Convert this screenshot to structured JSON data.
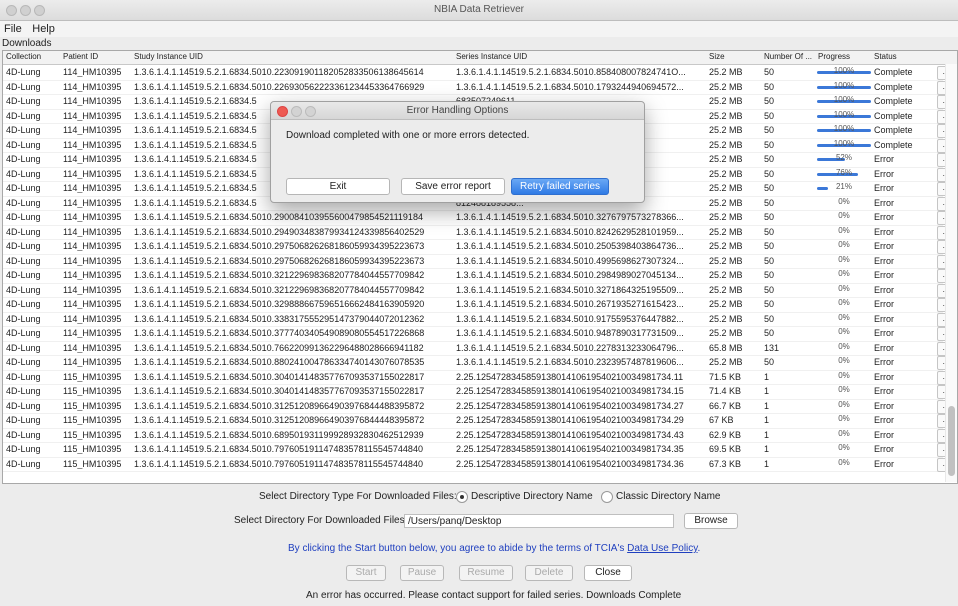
{
  "window": {
    "title": "NBIA Data Retriever"
  },
  "menu": [
    "File",
    "Help"
  ],
  "section_label": "Downloads",
  "columns": [
    "Collection",
    "Patient ID",
    "Study Instance UID",
    "Series Instance UID",
    "Size",
    "Number Of ...",
    "Progress",
    "Status"
  ],
  "rows": [
    {
      "collection": "4D-Lung",
      "patient": "114_HM10395",
      "study": "1.3.6.1.4.1.14519.5.2.1.6834.5010.223091901182052833506138645614",
      "series": "1.3.6.1.4.1.14519.5.2.1.6834.5010.858408007824741O...",
      "size": "25.2 MB",
      "number": "50",
      "progress": 100,
      "pct": "100%",
      "status": "Complete"
    },
    {
      "collection": "4D-Lung",
      "patient": "114_HM10395",
      "study": "1.3.6.1.4.1.14519.5.2.1.6834.5010.226930562223361234453364766929",
      "series": "1.3.6.1.4.1.14519.5.2.1.6834.5010.17932449406945­72...",
      "size": "25.2 MB",
      "number": "50",
      "progress": 100,
      "pct": "100%",
      "status": "Complete"
    },
    {
      "collection": "4D-Lung",
      "patient": "114_HM10395",
      "study": "1.3.6.1.4.1.14519.5.2.1.6834.5",
      "series": "683507249611...",
      "size": "25.2 MB",
      "number": "50",
      "progress": 100,
      "pct": "100%",
      "status": "Complete"
    },
    {
      "collection": "4D-Lung",
      "patient": "114_HM10395",
      "study": "1.3.6.1.4.1.14519.5.2.1.6834.5",
      "series": "489989233820...",
      "size": "25.2 MB",
      "number": "50",
      "progress": 100,
      "pct": "100%",
      "status": "Complete"
    },
    {
      "collection": "4D-Lung",
      "patient": "114_HM10395",
      "study": "1.3.6.1.4.1.14519.5.2.1.6834.5",
      "series": "155783428324...",
      "size": "25.2 MB",
      "number": "50",
      "progress": 100,
      "pct": "100%",
      "status": "Complete"
    },
    {
      "collection": "4D-Lung",
      "patient": "114_HM10395",
      "study": "1.3.6.1.4.1.14519.5.2.1.6834.5",
      "series": "511404411627...",
      "size": "25.2 MB",
      "number": "50",
      "progress": 100,
      "pct": "100%",
      "status": "Complete"
    },
    {
      "collection": "4D-Lung",
      "patient": "114_HM10395",
      "study": "1.3.6.1.4.1.14519.5.2.1.6834.5",
      "series": "794725798723...",
      "size": "25.2 MB",
      "number": "50",
      "progress": 52,
      "pct": "52%",
      "status": "Error"
    },
    {
      "collection": "4D-Lung",
      "patient": "114_HM10395",
      "study": "1.3.6.1.4.1.14519.5.2.1.6834.5",
      "series": "663802629487...",
      "size": "25.2 MB",
      "number": "50",
      "progress": 76,
      "pct": "76%",
      "status": "Error"
    },
    {
      "collection": "4D-Lung",
      "patient": "114_HM10395",
      "study": "1.3.6.1.4.1.14519.5.2.1.6834.5",
      "series": "465140066424...",
      "size": "25.2 MB",
      "number": "50",
      "progress": 21,
      "pct": "21%",
      "status": "Error"
    },
    {
      "collection": "4D-Lung",
      "patient": "114_HM10395",
      "study": "1.3.6.1.4.1.14519.5.2.1.6834.5",
      "series": "812488189558...",
      "size": "25.2 MB",
      "number": "50",
      "progress": 0,
      "pct": "0%",
      "status": "Error"
    },
    {
      "collection": "4D-Lung",
      "patient": "114_HM10395",
      "study": "1.3.6.1.4.1.14519.5.2.1.6834.5010.290084103955600479854521119184",
      "series": "1.3.6.1.4.1.14519.5.2.1.6834.5010.3276797573278366...",
      "size": "25.2 MB",
      "number": "50",
      "progress": 0,
      "pct": "0%",
      "status": "Error"
    },
    {
      "collection": "4D-Lung",
      "patient": "114_HM10395",
      "study": "1.3.6.1.4.1.14519.5.2.1.6834.5010.294903483879934124339856402529",
      "series": "1.3.6.1.4.1.14519.5.2.1.6834.5010.8242629528101959...",
      "size": "25.2 MB",
      "number": "50",
      "progress": 0,
      "pct": "0%",
      "status": "Error"
    },
    {
      "collection": "4D-Lung",
      "patient": "114_HM10395",
      "study": "1.3.6.1.4.1.14519.5.2.1.6834.5010.297506826268186059934395223673",
      "series": "1.3.6.1.4.1.14519.5.2.1.6834.5010.2505398403864736...",
      "size": "25.2 MB",
      "number": "50",
      "progress": 0,
      "pct": "0%",
      "status": "Error"
    },
    {
      "collection": "4D-Lung",
      "patient": "114_HM10395",
      "study": "1.3.6.1.4.1.14519.5.2.1.6834.5010.297506826268186059934395223673",
      "series": "1.3.6.1.4.1.14519.5.2.1.6834.5010.4995698627307324...",
      "size": "25.2 MB",
      "number": "50",
      "progress": 0,
      "pct": "0%",
      "status": "Error"
    },
    {
      "collection": "4D-Lung",
      "patient": "114_HM10395",
      "study": "1.3.6.1.4.1.14519.5.2.1.6834.5010.321229698368207784044557709842",
      "series": "1.3.6.1.4.1.14519.5.2.1.6834.5010.2984989027045134...",
      "size": "25.2 MB",
      "number": "50",
      "progress": 0,
      "pct": "0%",
      "status": "Error"
    },
    {
      "collection": "4D-Lung",
      "patient": "114_HM10395",
      "study": "1.3.6.1.4.1.14519.5.2.1.6834.5010.321229698368207784044557709842",
      "series": "1.3.6.1.4.1.14519.5.2.1.6834.5010.3271864325195509...",
      "size": "25.2 MB",
      "number": "50",
      "progress": 0,
      "pct": "0%",
      "status": "Error"
    },
    {
      "collection": "4D-Lung",
      "patient": "114_HM10395",
      "study": "1.3.6.1.4.1.14519.5.2.1.6834.5010.329888667596516662484163905920",
      "series": "1.3.6.1.4.1.14519.5.2.1.6834.5010.2671935271615423...",
      "size": "25.2 MB",
      "number": "50",
      "progress": 0,
      "pct": "0%",
      "status": "Error"
    },
    {
      "collection": "4D-Lung",
      "patient": "114_HM10395",
      "study": "1.3.6.1.4.1.14519.5.2.1.6834.5010.338317555295147379044072012362",
      "series": "1.3.6.1.4.1.14519.5.2.1.6834.5010.9175595376447882...",
      "size": "25.2 MB",
      "number": "50",
      "progress": 0,
      "pct": "0%",
      "status": "Error"
    },
    {
      "collection": "4D-Lung",
      "patient": "114_HM10395",
      "study": "1.3.6.1.4.1.14519.5.2.1.6834.5010.377740340549089080554517226868",
      "series": "1.3.6.1.4.1.14519.5.2.1.6834.5010.9487890317731509...",
      "size": "25.2 MB",
      "number": "50",
      "progress": 0,
      "pct": "0%",
      "status": "Error"
    },
    {
      "collection": "4D-Lung",
      "patient": "114_HM10395",
      "study": "1.3.6.1.4.1.14519.5.2.1.6834.5010.766220991362296488028666941182",
      "series": "1.3.6.1.4.1.14519.5.2.1.6834.5010.2278313233064796...",
      "size": "65.8 MB",
      "number": "131",
      "progress": 0,
      "pct": "0%",
      "status": "Error"
    },
    {
      "collection": "4D-Lung",
      "patient": "114_HM10395",
      "study": "1.3.6.1.4.1.14519.5.2.1.6834.5010.880241004786334740143076078535",
      "series": "1.3.6.1.4.1.14519.5.2.1.6834.5010.2323957487819606...",
      "size": "25.2 MB",
      "number": "50",
      "progress": 0,
      "pct": "0%",
      "status": "Error"
    },
    {
      "collection": "4D-Lung",
      "patient": "115_HM10395",
      "study": "1.3.6.1.4.1.14519.5.2.1.6834.5010.304014148357767093537155022817",
      "series": "2.25.125472834585913801410619540210034981734.11",
      "size": "71.5 KB",
      "number": "1",
      "progress": 0,
      "pct": "0%",
      "status": "Error"
    },
    {
      "collection": "4D-Lung",
      "patient": "115_HM10395",
      "study": "1.3.6.1.4.1.14519.5.2.1.6834.5010.304014148357767093537155022817",
      "series": "2.25.125472834585913801410619540210034981734.15",
      "size": "71.4 KB",
      "number": "1",
      "progress": 0,
      "pct": "0%",
      "status": "Error"
    },
    {
      "collection": "4D-Lung",
      "patient": "115_HM10395",
      "study": "1.3.6.1.4.1.14519.5.2.1.6834.5010.312512089664903976844488395872",
      "series": "2.25.125472834585913801410619540210034981734.27",
      "size": "66.7 KB",
      "number": "1",
      "progress": 0,
      "pct": "0%",
      "status": "Error"
    },
    {
      "collection": "4D-Lung",
      "patient": "115_HM10395",
      "study": "1.3.6.1.4.1.14519.5.2.1.6834.5010.312512089664903976844448395872",
      "series": "2.25.125472834585913801410619540210034981734.29",
      "size": "67 KB",
      "number": "1",
      "progress": 0,
      "pct": "0%",
      "status": "Error"
    },
    {
      "collection": "4D-Lung",
      "patient": "115_HM10395",
      "study": "1.3.6.1.4.1.14519.5.2.1.6834.5010.689501931199928932830462512939",
      "series": "2.25.125472834585913801410619540210034981734.43",
      "size": "62.9 KB",
      "number": "1",
      "progress": 0,
      "pct": "0%",
      "status": "Error"
    },
    {
      "collection": "4D-Lung",
      "patient": "115_HM10395",
      "study": "1.3.6.1.4.1.14519.5.2.1.6834.5010.797605191147483578115545744840",
      "series": "2.25.125472834585913801410619540210034981734.35",
      "size": "69.5 KB",
      "number": "1",
      "progress": 0,
      "pct": "0%",
      "status": "Error"
    },
    {
      "collection": "4D-Lung",
      "patient": "115_HM10395",
      "study": "1.3.6.1.4.1.14519.5.2.1.6834.5010.797605191147483578115545744840",
      "series": "2.25.125472834585913801410619540210034981734.36",
      "size": "67.3 KB",
      "number": "1",
      "progress": 0,
      "pct": "0%",
      "status": "Error"
    }
  ],
  "row_more_label": "...",
  "dir_type": {
    "label": "Select Directory Type For Downloaded Files:",
    "opt1": "Descriptive Directory Name",
    "opt2": "Classic Directory Name"
  },
  "dir": {
    "label": "Select Directory For Downloaded Files:",
    "value": "/Users/panq/Desktop",
    "browse": "Browse"
  },
  "terms": {
    "pre": "By clicking the Start button below, you agree to abide by the terms of TCIA's",
    "link": "Data Use Policy",
    "post": "."
  },
  "controls": {
    "start": "Start",
    "pause": "Pause",
    "resume": "Resume",
    "delete": "Delete",
    "close": "Close"
  },
  "status_message": "An error has occurred. Please contact support for failed series. Downloads Complete",
  "dialog": {
    "title": "Error Handling Options",
    "message": "Download completed with one or more errors detected.",
    "exit": "Exit",
    "save": "Save error report",
    "retry": "Retry failed series"
  },
  "colors": {
    "progress": "#3b78d8",
    "close_dot": "#ee5a52",
    "primary_button": "#2f7ae5"
  }
}
